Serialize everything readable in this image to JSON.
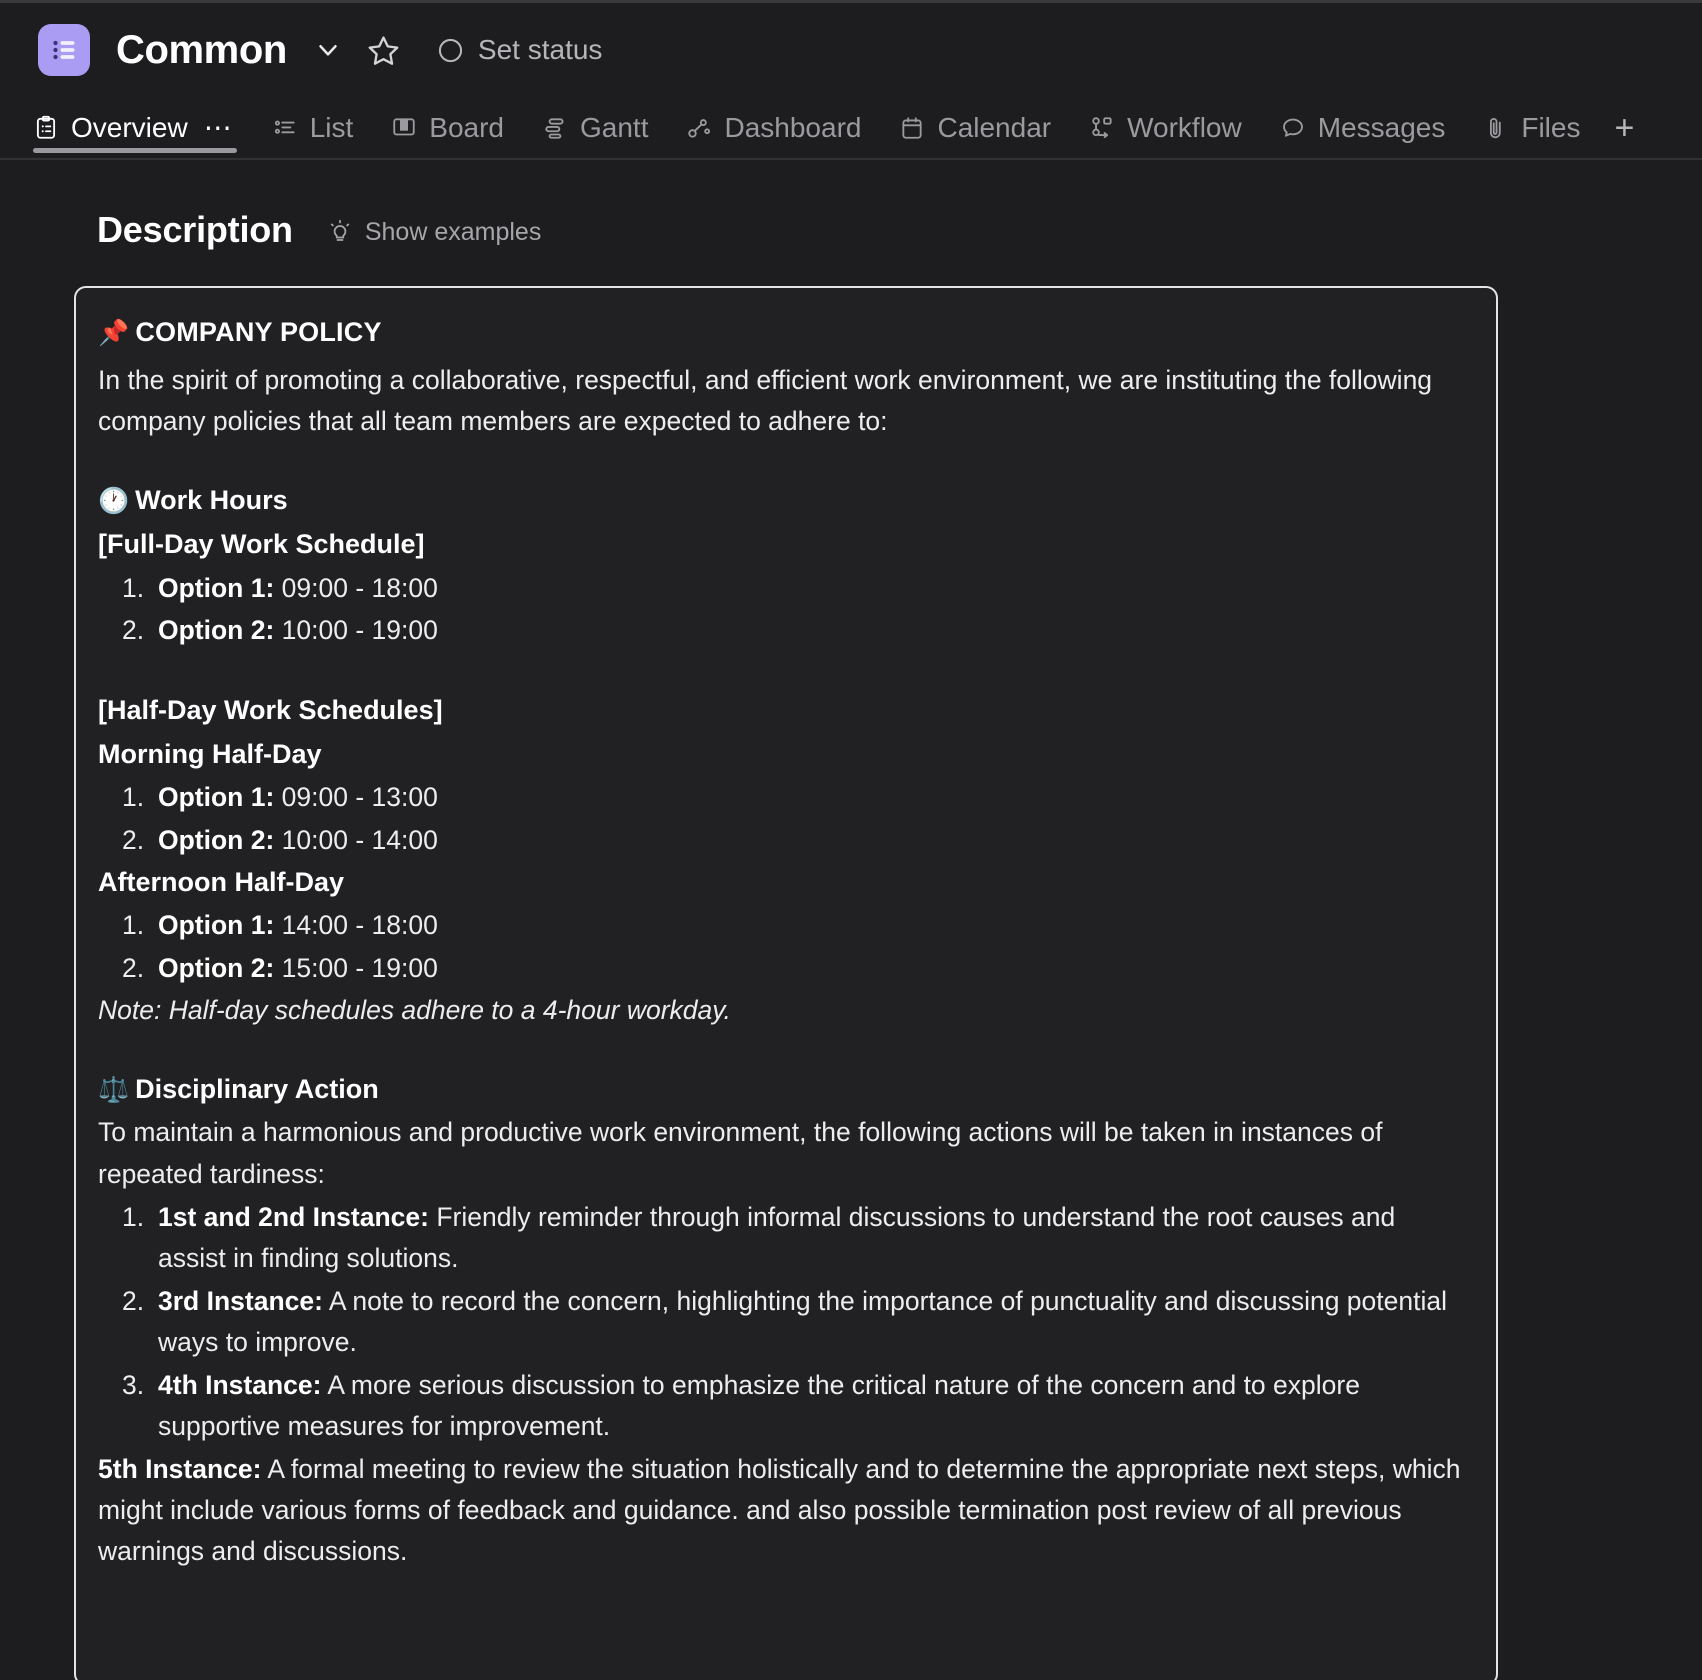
{
  "header": {
    "project_icon": "list-square-icon",
    "title": "Common",
    "chevron": "chevron-down-icon",
    "star": "star-outline-icon",
    "status_icon": "circle-outline-icon",
    "set_status_label": "Set status",
    "accent_color": "#a99cf2"
  },
  "tabs": {
    "items": [
      {
        "label": "Overview",
        "icon": "clipboard-list-icon",
        "active": true
      },
      {
        "label": "List",
        "icon": "list-icon",
        "active": false
      },
      {
        "label": "Board",
        "icon": "board-icon",
        "active": false
      },
      {
        "label": "Gantt",
        "icon": "gantt-icon",
        "active": false
      },
      {
        "label": "Dashboard",
        "icon": "dashboard-nodes-icon",
        "active": false
      },
      {
        "label": "Calendar",
        "icon": "calendar-icon",
        "active": false
      },
      {
        "label": "Workflow",
        "icon": "workflow-icon",
        "active": false
      },
      {
        "label": "Messages",
        "icon": "chat-bubble-icon",
        "active": false
      },
      {
        "label": "Files",
        "icon": "paperclip-icon",
        "active": false
      }
    ],
    "overview_more": "⋯",
    "add_tab": "+"
  },
  "description": {
    "heading": "Description",
    "show_examples_label": "Show examples",
    "show_examples_icon": "lightbulb-icon"
  },
  "policy": {
    "pin_emoji": "📌",
    "title": "COMPANY POLICY",
    "intro": "In the spirit of promoting a collaborative, respectful, and efficient work environment, we are instituting the following company policies that all team members are expected to adhere to:",
    "work_hours": {
      "emoji": "🕐",
      "heading": "Work Hours",
      "full_day": {
        "heading": "[Full-Day Work Schedule]",
        "options": [
          {
            "label": "Option 1:",
            "value": "09:00 - 18:00"
          },
          {
            "label": "Option 2:",
            "value": "10:00 - 19:00"
          }
        ]
      },
      "half_day": {
        "heading": "[Half-Day Work Schedules]",
        "morning": {
          "heading": "Morning Half-Day",
          "options": [
            {
              "label": "Option 1:",
              "value": "09:00 - 13:00"
            },
            {
              "label": "Option 2:",
              "value": "10:00 - 14:00"
            }
          ]
        },
        "afternoon": {
          "heading": "Afternoon Half-Day",
          "options": [
            {
              "label": "Option 1:",
              "value": "14:00 - 18:00"
            },
            {
              "label": "Option 2:",
              "value": "15:00 - 19:00"
            }
          ]
        },
        "note": "Note: Half-day schedules adhere to a 4-hour workday."
      }
    },
    "disciplinary": {
      "emoji": "⚖️",
      "heading": "Disciplinary Action",
      "intro": "To maintain a harmonious and productive work environment, the following actions will be taken in instances of repeated tardiness:",
      "items": [
        {
          "label": "1st and 2nd Instance:",
          "text": "Friendly reminder through informal discussions to understand the root causes and assist in finding solutions."
        },
        {
          "label": "3rd Instance:",
          "text": "A note to record the concern, highlighting the importance of punctuality and discussing potential ways to improve."
        },
        {
          "label": "4th Instance:",
          "text": "A more serious discussion to emphasize the critical nature of the concern and to explore supportive measures for improvement."
        }
      ],
      "final": {
        "label": "5th Instance:",
        "text": "A formal meeting to review the situation holistically and to determine the appropriate next steps, which might include various forms of feedback and guidance. and also possible termination post review of all previous warnings and discussions."
      }
    }
  }
}
